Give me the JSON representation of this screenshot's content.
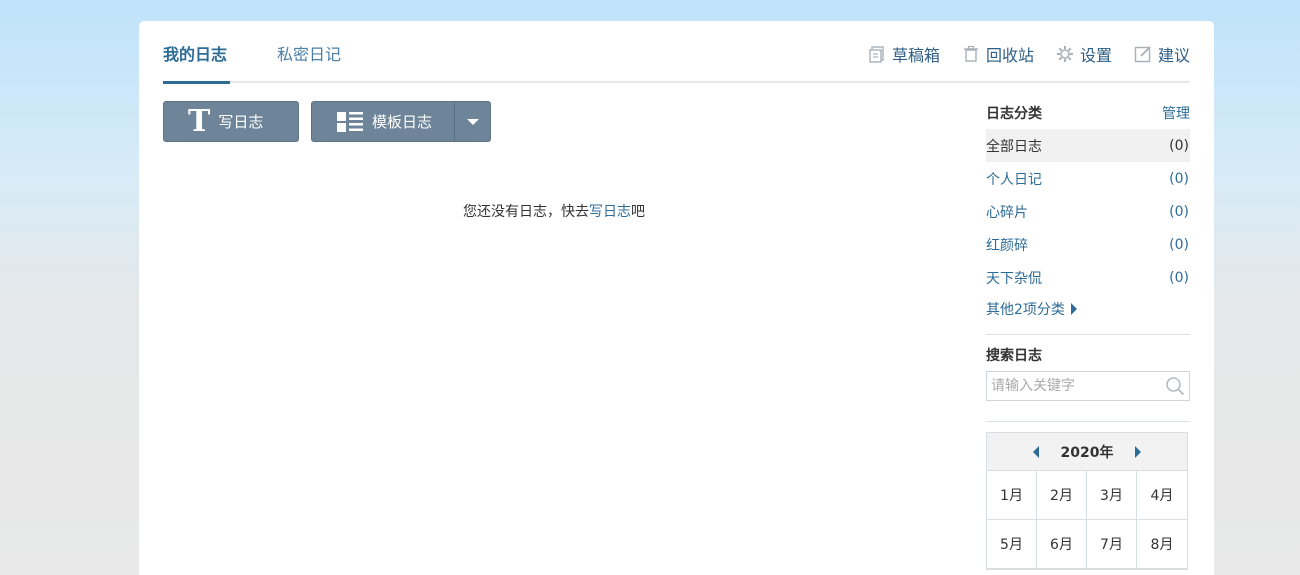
{
  "tabs": {
    "my_diary": "我的日志",
    "private_diary": "私密日记"
  },
  "toplinks": {
    "drafts": "草稿箱",
    "recycle": "回收站",
    "settings": "设置",
    "suggest": "建议"
  },
  "buttons": {
    "write": "写日志",
    "template": "模板日志"
  },
  "empty": {
    "text_before": "您还没有日志，快去",
    "link": "写日志",
    "text_after": "吧"
  },
  "sidebar": {
    "category_title": "日志分类",
    "manage": "管理",
    "categories": [
      {
        "name": "全部日志",
        "count": "(0)"
      },
      {
        "name": "个人日记",
        "count": "(0)"
      },
      {
        "name": "心碎片",
        "count": "(0)"
      },
      {
        "name": "红颜碎",
        "count": "(0)"
      },
      {
        "name": "天下杂侃",
        "count": "(0)"
      }
    ],
    "more": "其他2项分类",
    "search_title": "搜索日志",
    "search_placeholder": "请输入关键字"
  },
  "calendar": {
    "year": "2020年",
    "months": [
      "1月",
      "2月",
      "3月",
      "4月",
      "5月",
      "6月",
      "7月",
      "8月"
    ]
  },
  "colors": {
    "accent": "#2e6c98",
    "button_bg": "#6e8599",
    "panel_bg": "#ffffff"
  }
}
